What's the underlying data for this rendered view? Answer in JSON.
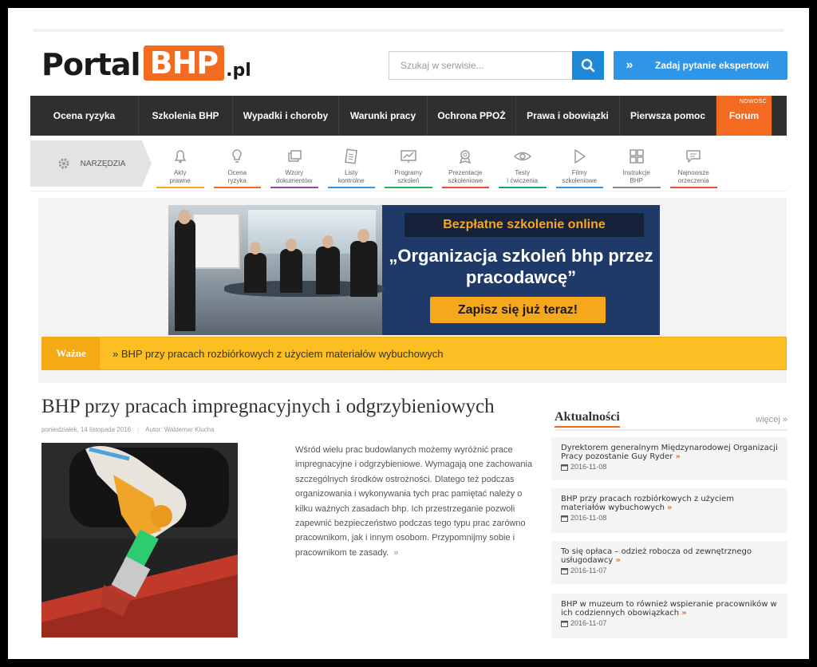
{
  "header": {
    "logo": {
      "portal": "Portal",
      "bhp": "BHP",
      "pl": ".pl"
    },
    "search_placeholder": "Szukaj w serwisie...",
    "ask_button": "Zadaj pytanie ekspertowi",
    "ask_chevron": "»"
  },
  "nav": {
    "items": [
      {
        "label": "Ocena ryzyka"
      },
      {
        "label": "Szkolenia BHP"
      },
      {
        "label": "Wypadki i choroby"
      },
      {
        "label": "Warunki pracy"
      },
      {
        "label": "Ochrona PPOŻ"
      },
      {
        "label": "Prawa i obowiązki"
      },
      {
        "label": "Pierwsza pomoc"
      },
      {
        "label": "Forum",
        "badge": "NOWOŚĆ"
      }
    ]
  },
  "tools": {
    "label": "NARZĘDZIA",
    "items": [
      {
        "label": "Akty\nprawne",
        "icon": "bell-icon",
        "color": "#f6a71c"
      },
      {
        "label": "Ocena\nryzyka",
        "icon": "lightbulb-icon",
        "color": "#f36a21"
      },
      {
        "label": "Wzory\ndokumentów",
        "icon": "documents-icon",
        "color": "#8e44ad"
      },
      {
        "label": "Listy\nkontrolne",
        "icon": "checklist-icon",
        "color": "#2f95e6"
      },
      {
        "label": "Programy\nszkoleń",
        "icon": "chart-icon",
        "color": "#27ae60"
      },
      {
        "label": "Prezentacje\nszkoleniowe",
        "icon": "medal-icon",
        "color": "#e74c3c"
      },
      {
        "label": "Testy\ni ćwiczenia",
        "icon": "eye-icon",
        "color": "#16a085"
      },
      {
        "label": "Filmy\nszkoleniowe",
        "icon": "play-icon",
        "color": "#2f95e6"
      },
      {
        "label": "Instrukcje\nBHP",
        "icon": "puzzle-icon",
        "color": "#7f8c8d"
      },
      {
        "label": "Najnowsze\norzeczenia",
        "icon": "chat-icon",
        "color": "#e74c3c"
      }
    ]
  },
  "banner": {
    "title": "Bezpłatne szkolenie online",
    "headline": "„Organizacja szkoleń bhp przez pracodawcę”",
    "cta": "Zapisz się już teraz!"
  },
  "important": {
    "label": "Ważne",
    "text": "» BHP przy pracach rozbiórkowych z użyciem materiałów wybuchowych"
  },
  "article": {
    "title": "BHP przy pracach impregnacyjnych i odgrzybieniowych",
    "date": "poniedziałek, 14 listopada 2016",
    "author": "Autor: Waldemar Klucha",
    "body": "Wśród wielu prac budowlanych możemy wyróżnić prace impregnacyjne i odgrzybieniowe. Wymagają one zachowania szczególnych środków ostrożności. Dlatego też podczas organizowania i wykonywania tych prac pamiętać należy o kilku ważnych zasadach bhp. Ich przestrzeganie pozwoli zapewnić bezpieczeństwo podczas tego typu prac zarówno pracownikom, jak i innym osobom. Przypomnijmy sobie i pracownikom te zasady.",
    "more": "»"
  },
  "news": {
    "heading": "Aktualności",
    "more": "więcej »",
    "items": [
      {
        "title": "Dyrektorem generalnym Międzynarodowej Organizacji Pracy pozostanie Guy Ryder",
        "date": "2016-11-08"
      },
      {
        "title": "BHP przy pracach rozbiórkowych z użyciem materiałów wybuchowych",
        "date": "2016-11-08"
      },
      {
        "title": "To się opłaca – odzież robocza od zewnętrznego usługodawcy",
        "date": "2016-11-07"
      },
      {
        "title": "BHP w muzeum to również wspieranie pracowników w ich codziennych obowiązkach",
        "date": "2016-11-07"
      }
    ],
    "arrow": "»"
  },
  "colors": {
    "accent": "#f36a21",
    "blue": "#2f95e6",
    "nav": "#2f2f2f",
    "important": "#fbbf24"
  }
}
